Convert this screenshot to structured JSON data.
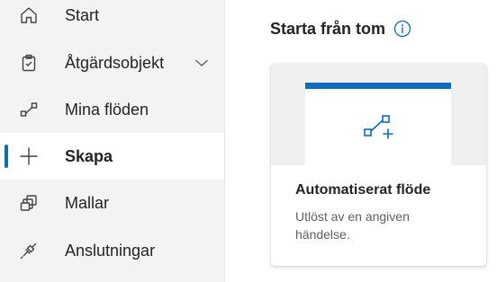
{
  "sidebar": {
    "items": [
      {
        "label": "Start",
        "icon": "home-icon"
      },
      {
        "label": "Åtgärdsobjekt",
        "icon": "clipboard-icon",
        "expandable": true
      },
      {
        "label": "Mina flöden",
        "icon": "flow-icon"
      },
      {
        "label": "Skapa",
        "icon": "plus-icon",
        "active": true
      },
      {
        "label": "Mallar",
        "icon": "templates-icon"
      },
      {
        "label": "Anslutningar",
        "icon": "connector-icon"
      }
    ]
  },
  "main": {
    "section_title": "Starta från tom",
    "card": {
      "title": "Automatiserat flöde",
      "description": "Utlöst av en angiven händelse."
    }
  },
  "colors": {
    "accent": "#0f6cbd",
    "sidebar_bg": "#f3f3f3",
    "text": "#242424",
    "muted_text": "#616161"
  }
}
